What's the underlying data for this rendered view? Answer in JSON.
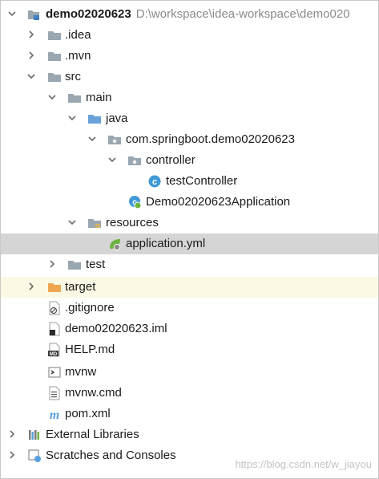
{
  "tree": {
    "root": {
      "name": "demo02020623",
      "path": "D:\\workspace\\idea-workspace\\demo020"
    },
    "idea": "idea",
    "mvn": "mvn",
    "src": "src",
    "main": "main",
    "java": "java",
    "package": "com.springboot.demo02020623",
    "controller": "controller",
    "test_controller": "testController",
    "application_class": "Demo02020623Application",
    "resources": "resources",
    "application_yml": "application.yml",
    "test": "test",
    "target": "target",
    "gitignore": ".gitignore",
    "iml": "demo02020623.iml",
    "help": "HELP.md",
    "mvnw": "mvnw",
    "mvnw_cmd": "mvnw.cmd",
    "pom": "pom.xml",
    "external_libraries": "External Libraries",
    "scratches": "Scratches and Consoles"
  },
  "watermark": "https://blog.csdn.net/w_jiayou",
  "colors": {
    "folder": "#9aa7b0",
    "source_folder": "#6aa2d8",
    "excluded_folder": "#f0a650",
    "class_icon": "#3f9ad6",
    "spring": "#6db33f",
    "selection": "#d5d5d5",
    "excluded_row": "#fbf9e3"
  },
  "icons": [
    "chevron-down-icon",
    "chevron-right-icon",
    "module-icon",
    "folder-icon",
    "source-folder-icon",
    "package-icon",
    "class-icon",
    "spring-boot-class-icon",
    "resources-folder-icon",
    "yaml-icon",
    "excluded-folder-icon",
    "gitignore-file-icon",
    "iml-file-icon",
    "markdown-file-icon",
    "shell-script-icon",
    "cmd-file-icon",
    "maven-icon",
    "libraries-icon",
    "scratches-icon"
  ]
}
